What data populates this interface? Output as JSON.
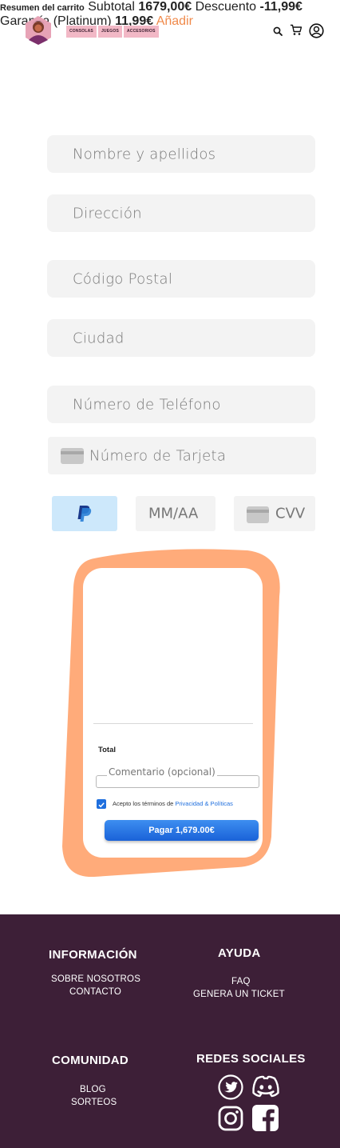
{
  "header": {
    "nav": [
      "CONSOLAS",
      "JUEGOS",
      "ACCESORIOS"
    ]
  },
  "form": {
    "name_placeholder": "Nombre y apellidos",
    "address_placeholder": "Dirección",
    "postal_placeholder": "Código Postal",
    "city_placeholder": "Ciudad",
    "phone_placeholder": "Número de Teléfono",
    "card_placeholder": "Número de Tarjeta",
    "expiry_placeholder": "MM/AA",
    "cvv_placeholder": "CVV"
  },
  "summary": {
    "title": "Resumen del carrito",
    "subtotal_label": "Subtotal",
    "subtotal_value": "1679,00€",
    "discount_label": "Descuento",
    "discount_value": "-11,99€",
    "warranty_label": "Garantía (Platinum)",
    "warranty_value": "11,99€",
    "add_link": "Añadir",
    "total_label": "Total",
    "comment_placeholder": "Comentario (opcional)",
    "terms_text": "Acepto los términos de ",
    "terms_link": "Privacidad & Políticas",
    "pay_button": "Pagar 1,679.00€"
  },
  "footer": {
    "info_title": "INFORMACIÓN",
    "info_links": [
      "SOBRE NOSOTROS",
      "CONTACTO"
    ],
    "help_title": "AYUDA",
    "help_links": [
      "FAQ",
      "GENERA UN TICKET"
    ],
    "community_title": "COMUNIDAD",
    "community_links": [
      "BLOG",
      "SORTEOS"
    ],
    "social_title": "REDES SOCIALES"
  },
  "colors": {
    "blob": "#ffab7a",
    "footer_bg": "#3d1f37",
    "nav_bg": "#f2b8c6",
    "accent_blue": "#1f6fde",
    "add_link": "#f08a4b"
  },
  "icons": [
    "logo-avatar-icon",
    "search-icon",
    "cart-icon",
    "user-icon",
    "card-icon",
    "paypal-icon",
    "check-icon",
    "twitter-icon",
    "discord-icon",
    "instagram-icon",
    "facebook-icon"
  ]
}
